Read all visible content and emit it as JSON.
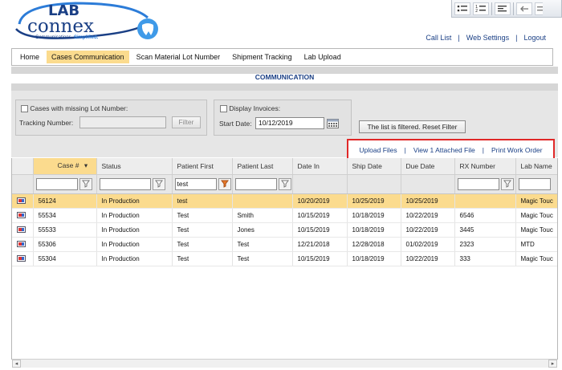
{
  "brand": {
    "logo_word1": "LAB",
    "logo_word2": "connex",
    "tagline_a": "Communications.",
    "tagline_b": "Simplified.",
    "colors": {
      "blue": "#1a3f85",
      "accent": "#2c7cd8",
      "highlight": "#fbdb8e",
      "action_border": "#e02828"
    }
  },
  "toolbar_icons": [
    "bullet-list-icon",
    "numbered-list-icon",
    "align-left-icon",
    "undo-arrow-icon"
  ],
  "top_links": [
    "Call List",
    "Web Settings",
    "Logout"
  ],
  "top_links_separator": "|",
  "nav": {
    "tabs": [
      "Home",
      "Cases Communication",
      "Scan Material Lot Number",
      "Shipment Tracking",
      "Lab Upload"
    ],
    "active": "Cases Communication"
  },
  "section_title": "COMMUNICATION",
  "filters": {
    "missing_lot_label": "Cases with missing Lot Number:",
    "missing_lot_checked": false,
    "tracking_label": "Tracking Number:",
    "tracking_value": "",
    "filter_button": "Filter",
    "display_invoices_label": "Display Invoices:",
    "display_invoices_checked": false,
    "start_date_label": "Start Date:",
    "start_date_value": "10/12/2019",
    "reset_button": "The list is filtered. Reset Filter"
  },
  "actions": {
    "upload": "Upload Files",
    "attached": "View 1 Attached File",
    "print": "Print Work Order",
    "separator": "|"
  },
  "grid": {
    "columns": [
      "",
      "Case #",
      "Status",
      "Patient First",
      "Patient Last",
      "Date In",
      "Ship Date",
      "Due Date",
      "RX Number",
      "Lab Name"
    ],
    "sort_column": "Case #",
    "sort_indicator": "▾",
    "filter_values": {
      "patient_first": "test"
    },
    "rows": [
      {
        "case": "56124",
        "status": "In Production",
        "first": "test",
        "last": "",
        "date_in": "10/20/2019",
        "ship": "10/25/2019",
        "due": "10/25/2019",
        "rx": "",
        "lab": "Magic Touc",
        "selected": true
      },
      {
        "case": "55534",
        "status": "In Production",
        "first": "Test",
        "last": "Smith",
        "date_in": "10/15/2019",
        "ship": "10/18/2019",
        "due": "10/22/2019",
        "rx": "6546",
        "lab": "Magic Touc",
        "selected": false
      },
      {
        "case": "55533",
        "status": "In Production",
        "first": "Test",
        "last": "Jones",
        "date_in": "10/15/2019",
        "ship": "10/18/2019",
        "due": "10/22/2019",
        "rx": "3445",
        "lab": "Magic Touc",
        "selected": false
      },
      {
        "case": "55306",
        "status": "In Production",
        "first": "Test",
        "last": "Test",
        "date_in": "12/21/2018",
        "ship": "12/28/2018",
        "due": "01/02/2019",
        "rx": "2323",
        "lab": "MTD",
        "selected": false
      },
      {
        "case": "55304",
        "status": "In Production",
        "first": "Test",
        "last": "Test",
        "date_in": "10/15/2019",
        "ship": "10/18/2019",
        "due": "10/22/2019",
        "rx": "333",
        "lab": "Magic Touc",
        "selected": false
      }
    ]
  }
}
